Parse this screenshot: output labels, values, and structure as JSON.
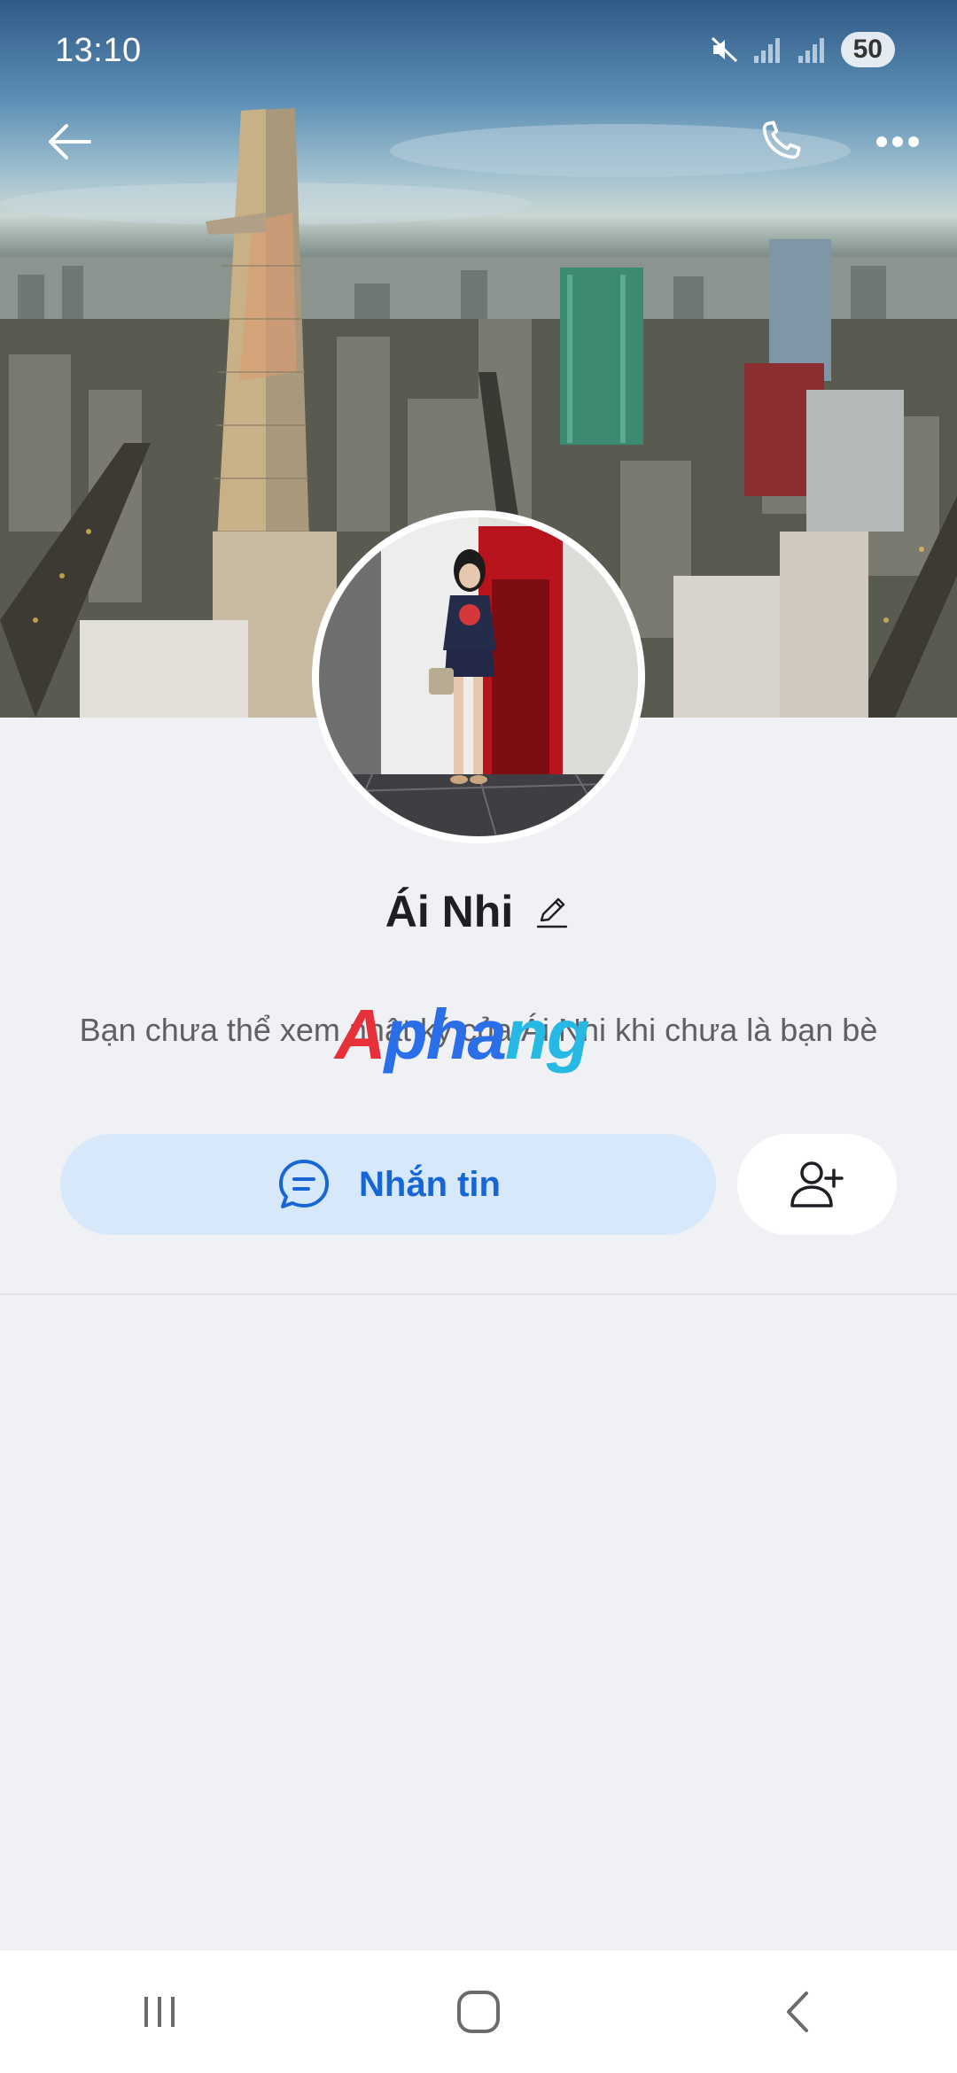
{
  "status_bar": {
    "time": "13:10",
    "battery": "50",
    "icons": [
      "mute-icon",
      "signal-icon",
      "signal-icon"
    ]
  },
  "top_bar": {
    "icons": [
      "back-arrow-icon",
      "phone-icon",
      "more-dots-icon"
    ]
  },
  "profile": {
    "name": "Ái Nhi",
    "info_text": "Bạn chưa thể xem nhật ký của Ái Nhi khi chưa là bạn bè"
  },
  "actions": {
    "message_label": "Nhắn tin",
    "message_icon": "chat-bubble-icon",
    "add_friend_icon": "add-user-icon"
  },
  "watermark": {
    "part_a": "A",
    "part_b": "pha",
    "part_c": "ng"
  },
  "colors": {
    "primary": "#1766d6",
    "message_button_bg": "#d7e8fb",
    "page_bg": "#f0f1f5"
  },
  "nav_bar": {
    "icons": [
      "recent-apps-icon",
      "home-icon",
      "back-icon"
    ]
  }
}
